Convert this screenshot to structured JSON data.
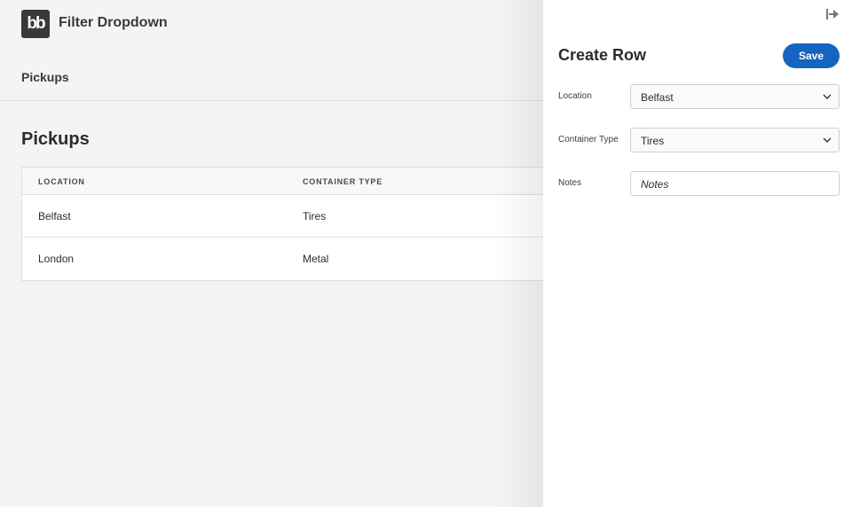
{
  "app": {
    "logo_text": "bb",
    "title": "Filter Dropdown"
  },
  "nav": {
    "items": [
      {
        "label": "Pickups"
      }
    ]
  },
  "page": {
    "heading": "Pickups"
  },
  "table": {
    "headers": [
      "LOCATION",
      "CONTAINER TYPE"
    ],
    "rows": [
      [
        "Belfast",
        "Tires"
      ],
      [
        "London",
        "Metal"
      ]
    ]
  },
  "panel": {
    "title": "Create Row",
    "save_label": "Save",
    "fields": [
      {
        "label": "Location",
        "value": "Belfast",
        "kind": "select"
      },
      {
        "label": "Container Type",
        "value": "Tires",
        "kind": "select"
      },
      {
        "label": "Notes",
        "placeholder": "Notes",
        "kind": "text"
      }
    ]
  },
  "colors": {
    "accent": "#1565c0",
    "logo_bg": "#393939"
  }
}
